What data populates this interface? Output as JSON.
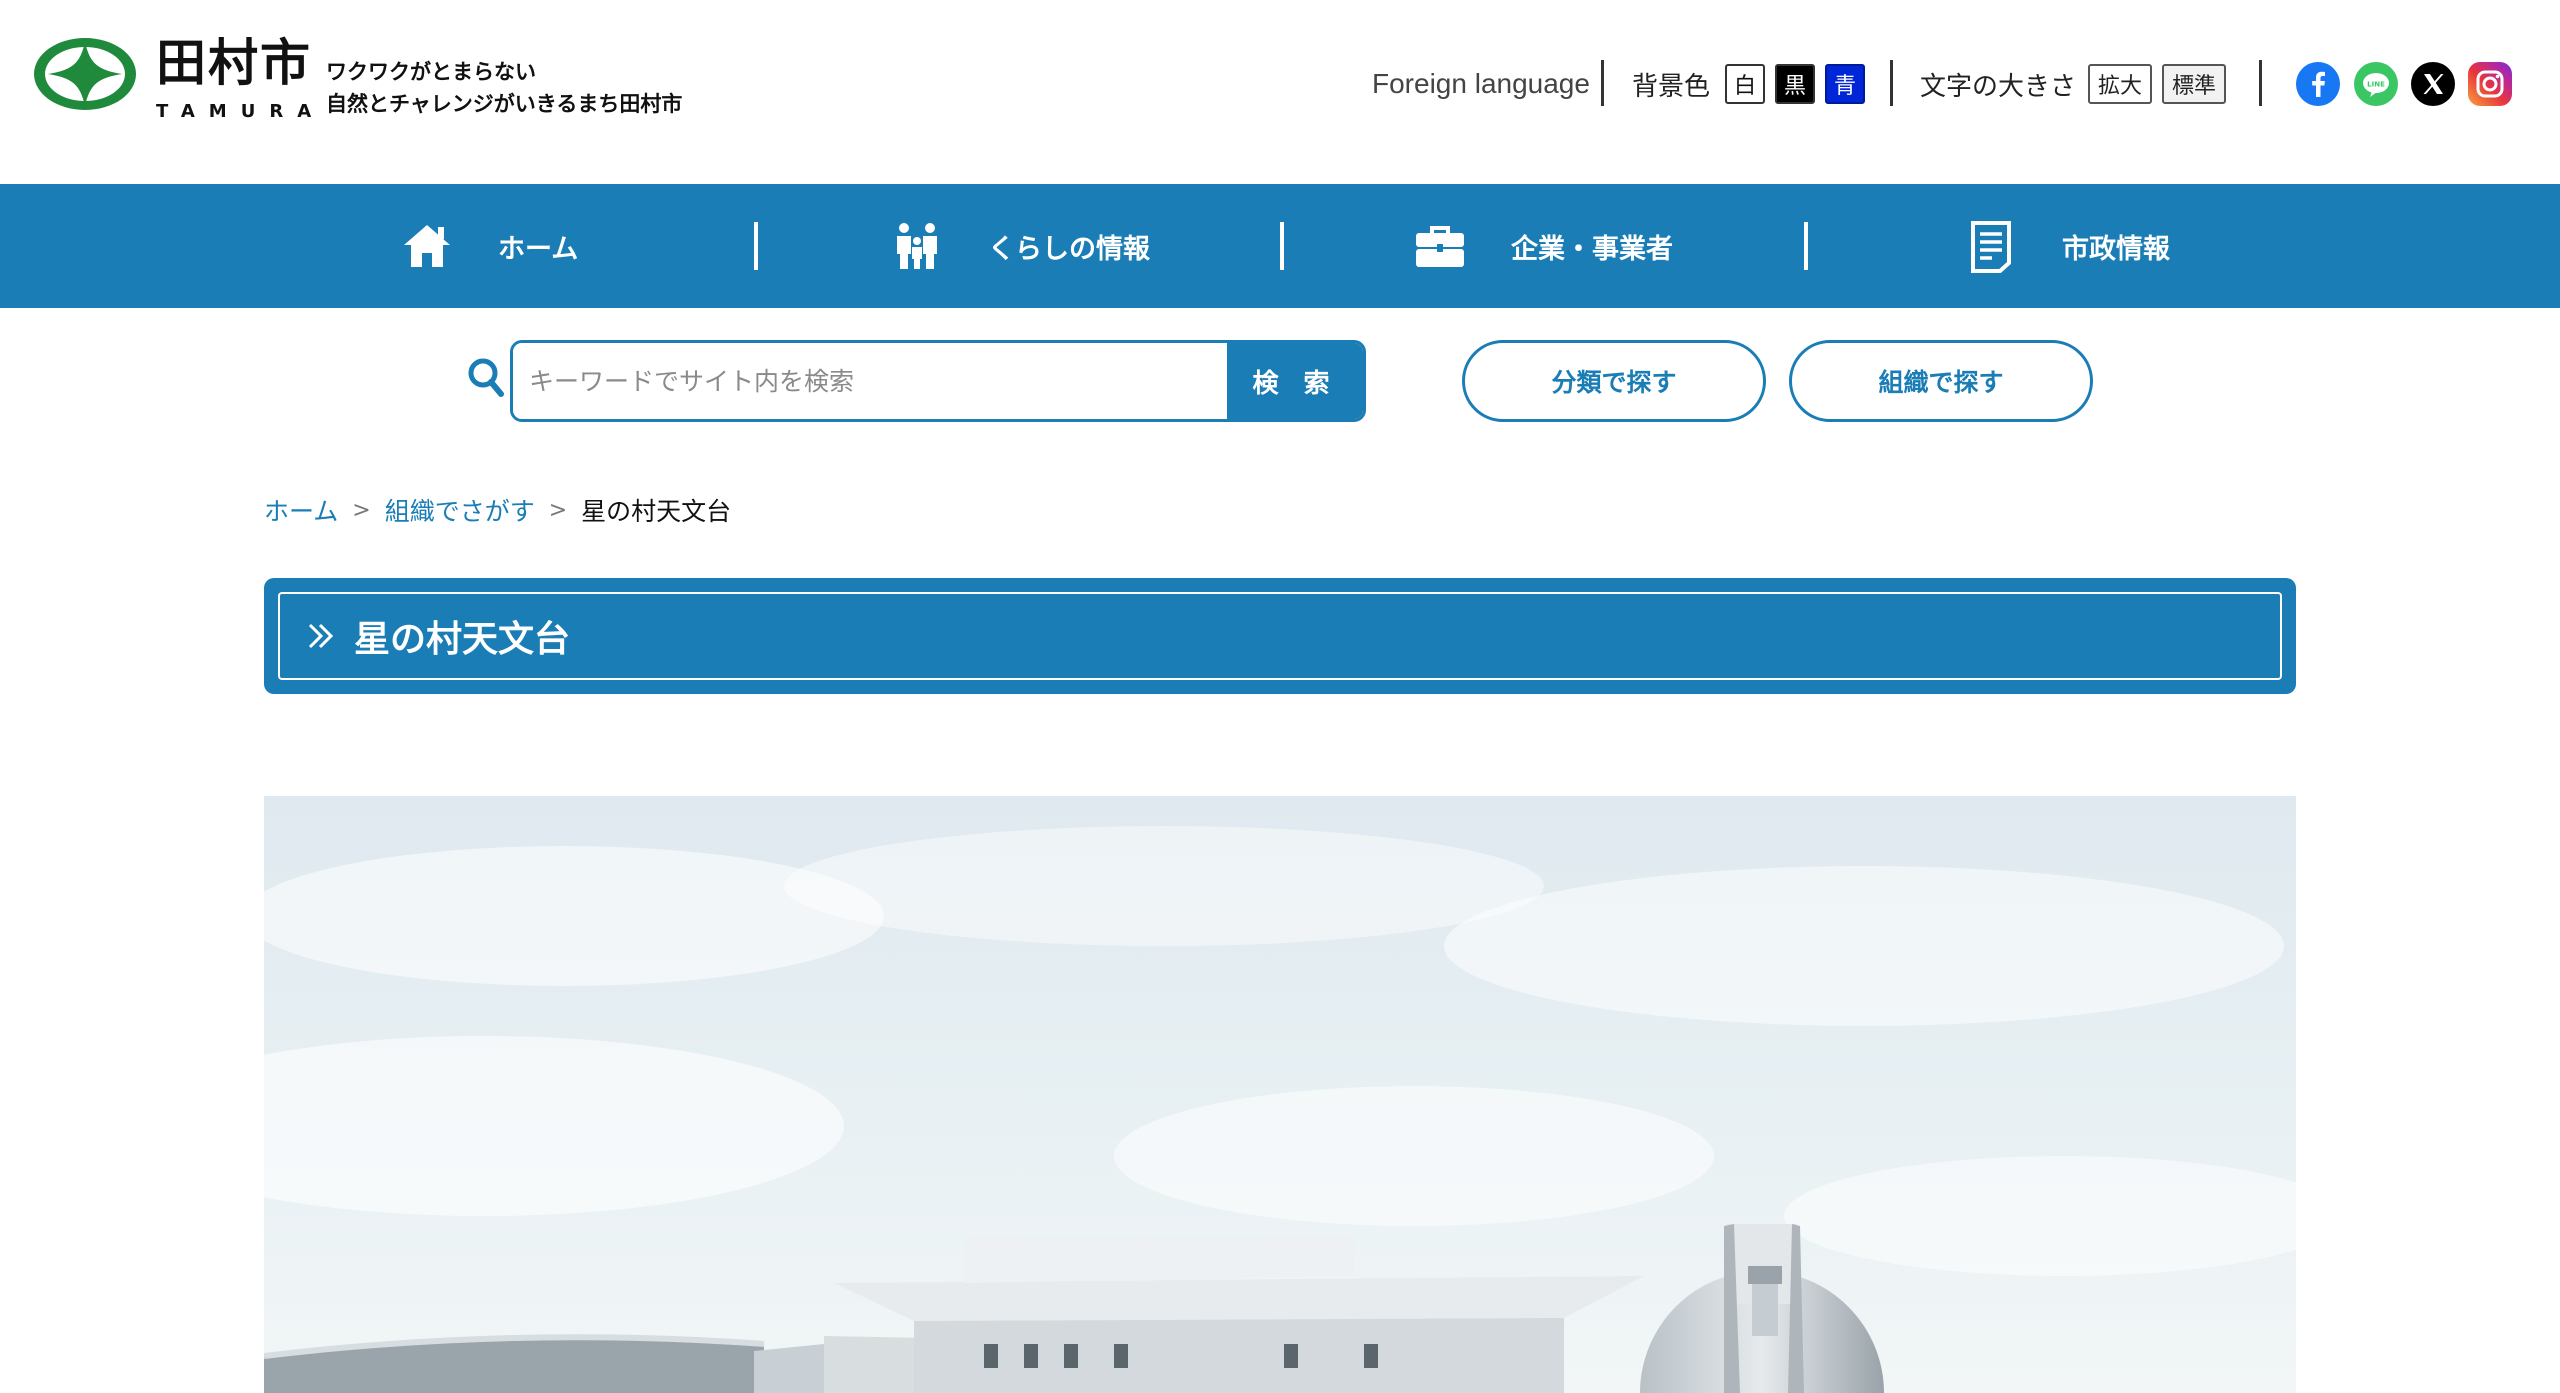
{
  "header": {
    "logo_name": "田村市",
    "logo_roman": "TAMURA",
    "tagline_line1": "ワクワクがとまらない",
    "tagline_line2": "自然とチャレンジがいきるまち田村市"
  },
  "utility": {
    "foreign_language": "Foreign language",
    "bg_color_label": "背景色",
    "bg_white": "白",
    "bg_black": "黒",
    "bg_blue": "青",
    "font_size_label": "文字の大きさ",
    "font_enlarge": "拡大",
    "font_standard": "標準"
  },
  "sns": [
    "facebook-icon",
    "line-icon",
    "x-icon",
    "instagram-icon"
  ],
  "nav": {
    "home": "ホーム",
    "life": "くらしの情報",
    "business": "企業・事業者",
    "city": "市政情報"
  },
  "search": {
    "placeholder": "キーワードでサイト内を検索",
    "button": "検 索",
    "by_category": "分類で探す",
    "by_organization": "組織で探す"
  },
  "breadcrumb": {
    "home": "ホーム",
    "org": "組織でさがす",
    "sep": ">",
    "current": "星の村天文台"
  },
  "page": {
    "title": "星の村天文台"
  },
  "colors": {
    "brand_blue": "#1a7db5",
    "logo_green": "#1f8a3b"
  }
}
